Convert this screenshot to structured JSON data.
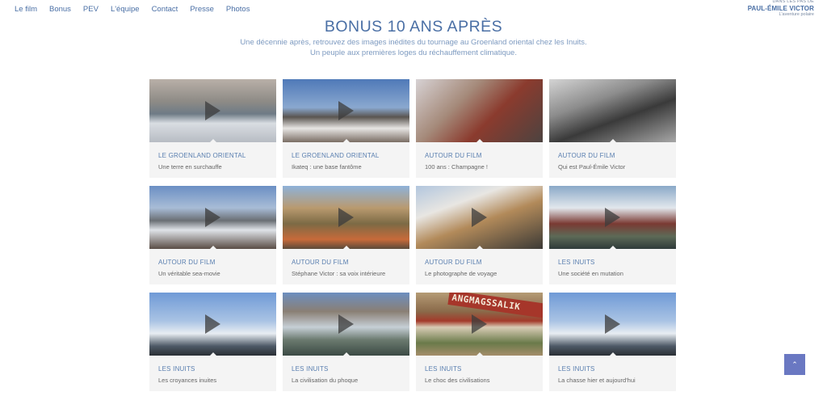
{
  "nav": {
    "items": [
      {
        "label": "Le film"
      },
      {
        "label": "Bonus"
      },
      {
        "label": "PEV"
      },
      {
        "label": "L'équipe"
      },
      {
        "label": "Contact"
      },
      {
        "label": "Presse"
      },
      {
        "label": "Photos"
      }
    ]
  },
  "brand": {
    "line1": "DANS LES PAS DE",
    "line2": "PAUL-ÉMILE VICTOR",
    "line3": "L'aventure polaire"
  },
  "header": {
    "title": "BONUS 10 ANS APRÈS",
    "subtitle_line1": "Une décennie après, retrouvez des images inédites du tournage au Groenland oriental chez les Inuits.",
    "subtitle_line2": "Un peuple aux premières loges du réchauffement climatique."
  },
  "cards": [
    {
      "category": "LE GROENLAND ORIENTAL",
      "caption": "Une terre en surchauffe"
    },
    {
      "category": "LE GROENLAND ORIENTAL",
      "caption": "Ikateq : une base fantôme"
    },
    {
      "category": "AUTOUR DU FILM",
      "caption": "100 ans : Champagne !"
    },
    {
      "category": "AUTOUR DU FILM",
      "caption": "Qui est Paul-Émile Victor"
    },
    {
      "category": "AUTOUR DU FILM",
      "caption": "Un véritable sea-movie"
    },
    {
      "category": "AUTOUR DU FILM",
      "caption": "Stéphane Victor : sa voix intérieure"
    },
    {
      "category": "AUTOUR DU FILM",
      "caption": "Le photographe de voyage"
    },
    {
      "category": "LES INUITS",
      "caption": "Une société en mutation"
    },
    {
      "category": "LES INUITS",
      "caption": "Les croyances inuites"
    },
    {
      "category": "LES INUITS",
      "caption": "La civilisation du phoque"
    },
    {
      "category": "LES INUITS",
      "caption": "Le choc des civilisations"
    },
    {
      "category": "LES INUITS",
      "caption": "La chasse hier et aujourd'hui"
    }
  ],
  "sign_text": "ANGMAGSSALIK",
  "scroll_top": {
    "label": "⌃"
  },
  "colors": {
    "accent": "#4a6fa5",
    "card_bg": "#f4f4f4",
    "scroll_button": "#6a78c2"
  }
}
